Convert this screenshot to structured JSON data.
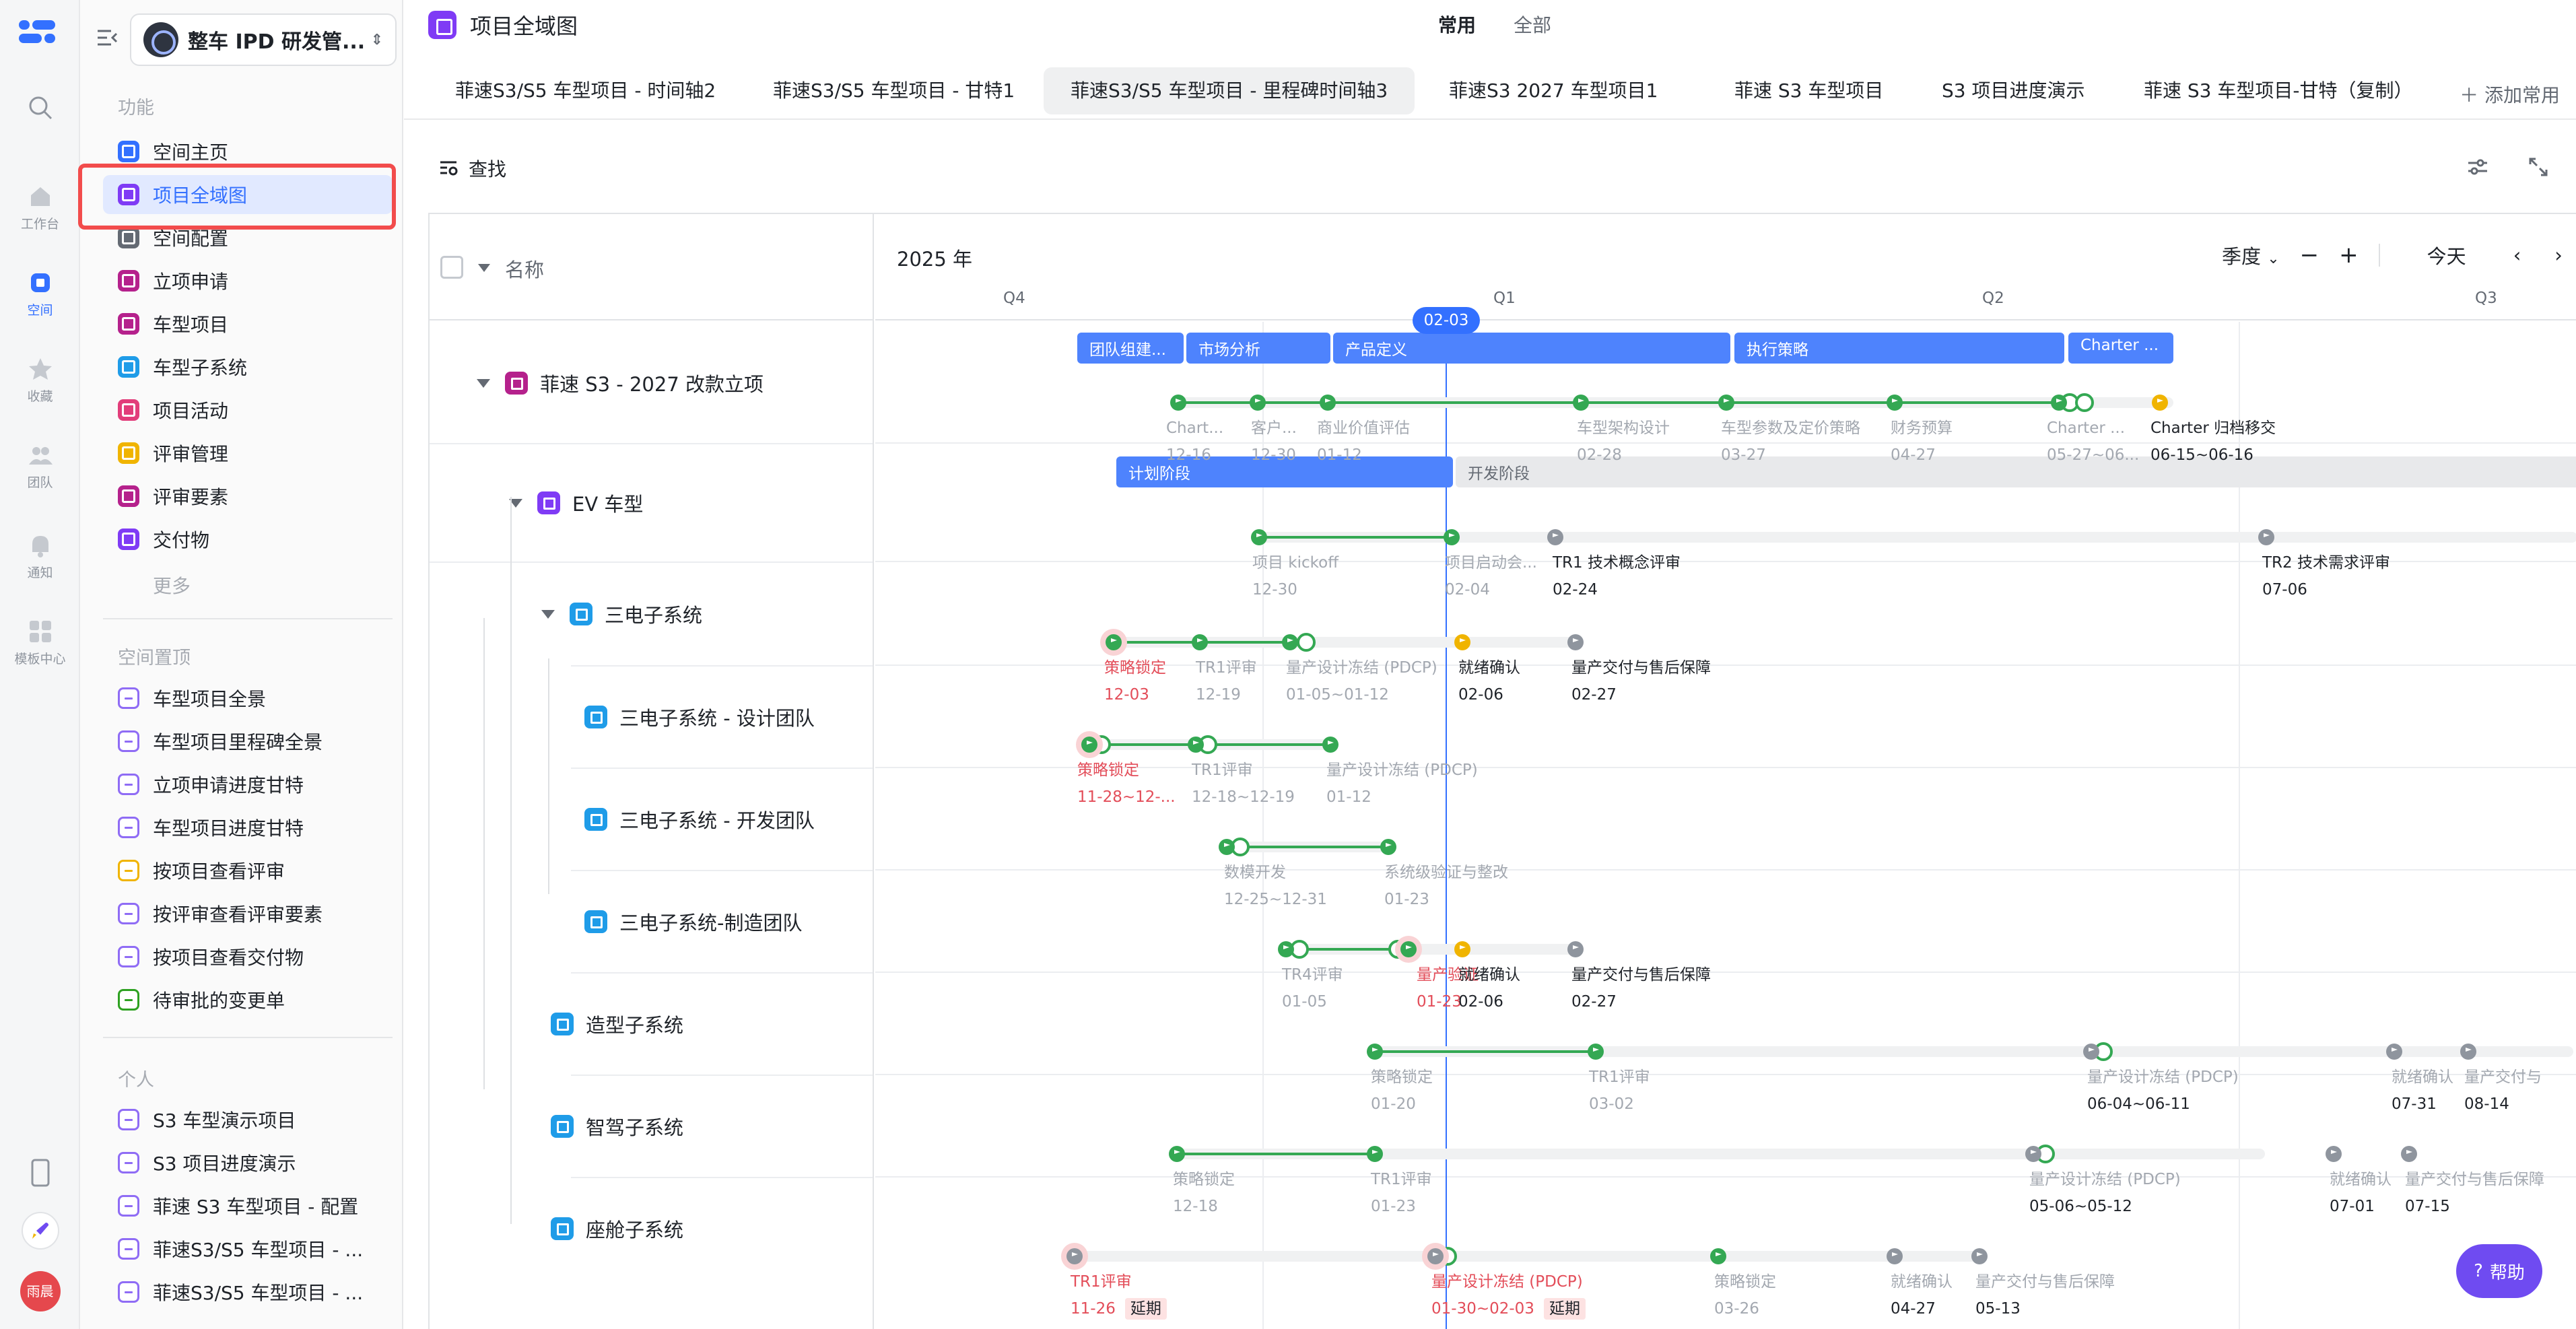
{
  "rail": {
    "items": [
      {
        "label": "工作台",
        "icon": "home-icon"
      },
      {
        "label": "空间",
        "icon": "space-icon"
      },
      {
        "label": "收藏",
        "icon": "star-icon"
      },
      {
        "label": "团队",
        "icon": "team-icon"
      },
      {
        "label": "通知",
        "icon": "bell-icon"
      },
      {
        "label": "模板中心",
        "icon": "template-icon"
      }
    ],
    "avatar_text": "雨晨"
  },
  "sidebar": {
    "space_name": "整车 IPD 研发管...",
    "section_func": "功能",
    "func_items": [
      {
        "label": "空间主页",
        "color": "#3370ff"
      },
      {
        "label": "项目全域图",
        "color": "#7f3bf5"
      },
      {
        "label": "空间配置",
        "color": "#646a73"
      },
      {
        "label": "立项申请",
        "color": "#b5218c"
      },
      {
        "label": "车型项目",
        "color": "#b5218c"
      },
      {
        "label": "车型子系统",
        "color": "#1f9ce8"
      },
      {
        "label": "项目活动",
        "color": "#e23d7a"
      },
      {
        "label": "评审管理",
        "color": "#f0b400"
      },
      {
        "label": "评审要素",
        "color": "#b5218c"
      },
      {
        "label": "交付物",
        "color": "#7f3bf5"
      }
    ],
    "more": "更多",
    "section_pinned": "空间置顶",
    "pinned_items": [
      {
        "label": "车型项目全景",
        "color": "#8f6cf5"
      },
      {
        "label": "车型项目里程碑全景",
        "color": "#8f6cf5"
      },
      {
        "label": "立项申请进度甘特",
        "color": "#8f6cf5"
      },
      {
        "label": "车型项目进度甘特",
        "color": "#8f6cf5"
      },
      {
        "label": "按项目查看评审",
        "color": "#f0b400"
      },
      {
        "label": "按评审查看评审要素",
        "color": "#8f6cf5"
      },
      {
        "label": "按项目查看交付物",
        "color": "#8f6cf5"
      },
      {
        "label": "待审批的变更单",
        "color": "#2ea121"
      }
    ],
    "section_personal": "个人",
    "personal_items": [
      {
        "label": "S3 车型演示项目",
        "color": "#8f6cf5"
      },
      {
        "label": "S3 项目进度演示",
        "color": "#8f6cf5"
      },
      {
        "label": "菲速 S3 车型项目 - 配置",
        "color": "#8f6cf5"
      },
      {
        "label": "菲速S3/S5 车型项目 - ...",
        "color": "#8f6cf5"
      },
      {
        "label": "菲速S3/S5 车型项目 - ...",
        "color": "#8f6cf5"
      }
    ]
  },
  "header": {
    "title": "项目全域图",
    "mode_tabs": [
      "常用",
      "全部"
    ]
  },
  "view_tabs": [
    "菲速S3/S5 车型项目 - 时间轴2",
    "菲速S3/S5 车型项目 - 甘特1",
    "菲速S3/S5 车型项目 - 里程碑时间轴3",
    "菲速S3 2027 车型项目1",
    "菲速 S3 车型项目",
    "S3 项目进度演示",
    "菲速 S3 车型项目-甘特（复制）"
  ],
  "add_favorite": "添加常用",
  "toolbar": {
    "find": "查找"
  },
  "gantt": {
    "name_header": "名称",
    "year": "2025 年",
    "scale": "季度",
    "today": "今天",
    "today_marker": "02-03",
    "quarters": [
      "Q4",
      "Q1",
      "Q2",
      "Q3"
    ],
    "rows": [
      {
        "name": "菲速 S3 - 2027 改款立项",
        "color": "#b5218c"
      },
      {
        "name": "EV 车型",
        "color": "#7f3bf5"
      },
      {
        "name": "三电子系统",
        "color": "#1f9ce8"
      },
      {
        "name": "三电子系统 - 设计团队",
        "color": "#1f9ce8"
      },
      {
        "name": "三电子系统 - 开发团队",
        "color": "#1f9ce8"
      },
      {
        "name": "三电子系统-制造团队",
        "color": "#1f9ce8"
      },
      {
        "name": "造型子系统",
        "color": "#1f9ce8"
      },
      {
        "name": "智驾子系统",
        "color": "#1f9ce8"
      },
      {
        "name": "座舱子系统",
        "color": "#1f9ce8"
      }
    ],
    "phase_bars": [
      "团队组建...",
      "市场分析",
      "产品定义",
      "执行策略",
      "Charter ...",
      "计划阶段",
      "开发阶段"
    ],
    "labels": {
      "r0": [
        [
          "Chart...",
          "12-16"
        ],
        [
          "客户...",
          "12-30"
        ],
        [
          "商业价值评估",
          "01-12"
        ],
        [
          "车型架构设计",
          "02-28"
        ],
        [
          "车型参数及定价策略",
          "03-27"
        ],
        [
          "财务预算",
          "04-27"
        ],
        [
          "Charter ...",
          "05-27~06..."
        ],
        [
          "Charter 归档移交",
          "06-15~06-16"
        ]
      ],
      "r1": [
        [
          "项目 kickoff",
          "12-30"
        ],
        [
          "项目启动会...",
          "02-04"
        ],
        [
          "TR1 技术概念评审",
          "02-24"
        ],
        [
          "TR2 技术需求评审",
          "07-06"
        ]
      ],
      "r2": [
        [
          "策略锁定",
          "12-03"
        ],
        [
          "TR1评审",
          "12-19"
        ],
        [
          "量产设计冻结 (PDCP)",
          "01-05~01-12"
        ],
        [
          "就绪确认",
          "02-06"
        ],
        [
          "量产交付与售后保障",
          "02-27"
        ]
      ],
      "r3": [
        [
          "策略锁定",
          "11-28~12-..."
        ],
        [
          "TR1评审",
          "12-18~12-19"
        ],
        [
          "量产设计冻结 (PDCP)",
          "01-12"
        ]
      ],
      "r4": [
        [
          "数模开发",
          "12-25~12-31"
        ],
        [
          "系统级验证与整改",
          "01-23"
        ]
      ],
      "r5": [
        [
          "TR4评审",
          "01-05"
        ],
        [
          "量产验证",
          "01-23"
        ],
        [
          "就绪确认",
          "02-06"
        ],
        [
          "量产交付与售后保障",
          "02-27"
        ]
      ],
      "r6": [
        [
          "策略锁定",
          "01-20"
        ],
        [
          "TR1评审",
          "03-02"
        ],
        [
          "量产设计冻结 (PDCP)",
          "06-04~06-11"
        ],
        [
          "就绪确认",
          "07-31"
        ],
        [
          "量产交付与",
          "08-14"
        ]
      ],
      "r7": [
        [
          "策略锁定",
          "12-18"
        ],
        [
          "TR1评审",
          "01-23"
        ],
        [
          "量产设计冻结 (PDCP)",
          "05-06~05-12"
        ],
        [
          "就绪确认",
          "07-01"
        ],
        [
          "量产交付与售后保障",
          "07-15"
        ]
      ],
      "r8": [
        [
          "TR1评审",
          "11-26"
        ],
        [
          "量产设计冻结 (PDCP)",
          "01-30~02-03"
        ],
        [
          "策略锁定",
          "03-26"
        ],
        [
          "就绪确认",
          "04-27"
        ],
        [
          "量产交付与售后保障",
          "05-13"
        ]
      ]
    },
    "delay_tag": "延期"
  },
  "help": "帮助"
}
